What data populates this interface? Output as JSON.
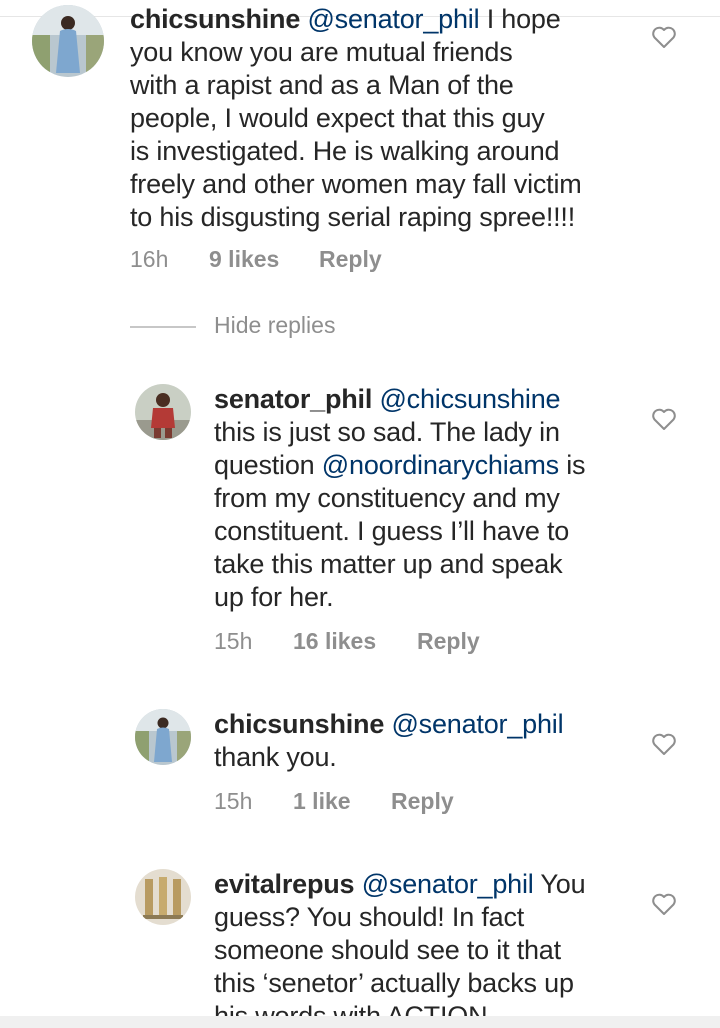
{
  "comments": [
    {
      "username": "chicsunshine",
      "mention": "@senator_phil",
      "lines": [
        " I hope",
        "you know you are mutual friends",
        "with a rapist and as a Man of the",
        "people, I would expect that this guy",
        "is investigated. He is walking around",
        "freely and other women may fall victim",
        "to his disgusting serial raping spree!!!!"
      ],
      "time": "16h",
      "likes": "9 likes",
      "reply": "Reply"
    },
    {
      "username": "senator_phil",
      "mention": "@chicsunshine",
      "lines_a": "this is just so sad. The lady in",
      "line_b_pre": "question ",
      "line_b_mention": "@noordinarychiams",
      "line_b_post": " is",
      "lines_rest": [
        "from my constituency and my",
        "constituent. I guess I’ll have to",
        "take this matter  up and speak",
        "up for her."
      ],
      "time": "15h",
      "likes": "16 likes",
      "reply": "Reply"
    },
    {
      "username": "chicsunshine",
      "mention": "@senator_phil",
      "lines": [
        "thank you."
      ],
      "time": "15h",
      "likes": "1 like",
      "reply": "Reply"
    },
    {
      "username": "evitalrepus",
      "mention": "@senator_phil",
      "first_post": " You",
      "lines": [
        "guess? You should! In fact",
        "someone should see to it that",
        "this ‘senetor’ actually backs up",
        "his words with ACTION"
      ]
    }
  ],
  "hide_replies": "Hide replies",
  "icons": {
    "like": "heart-outline-icon"
  },
  "colors": {
    "text": "#262626",
    "meta": "#8e8e8e",
    "mention": "#003569"
  }
}
